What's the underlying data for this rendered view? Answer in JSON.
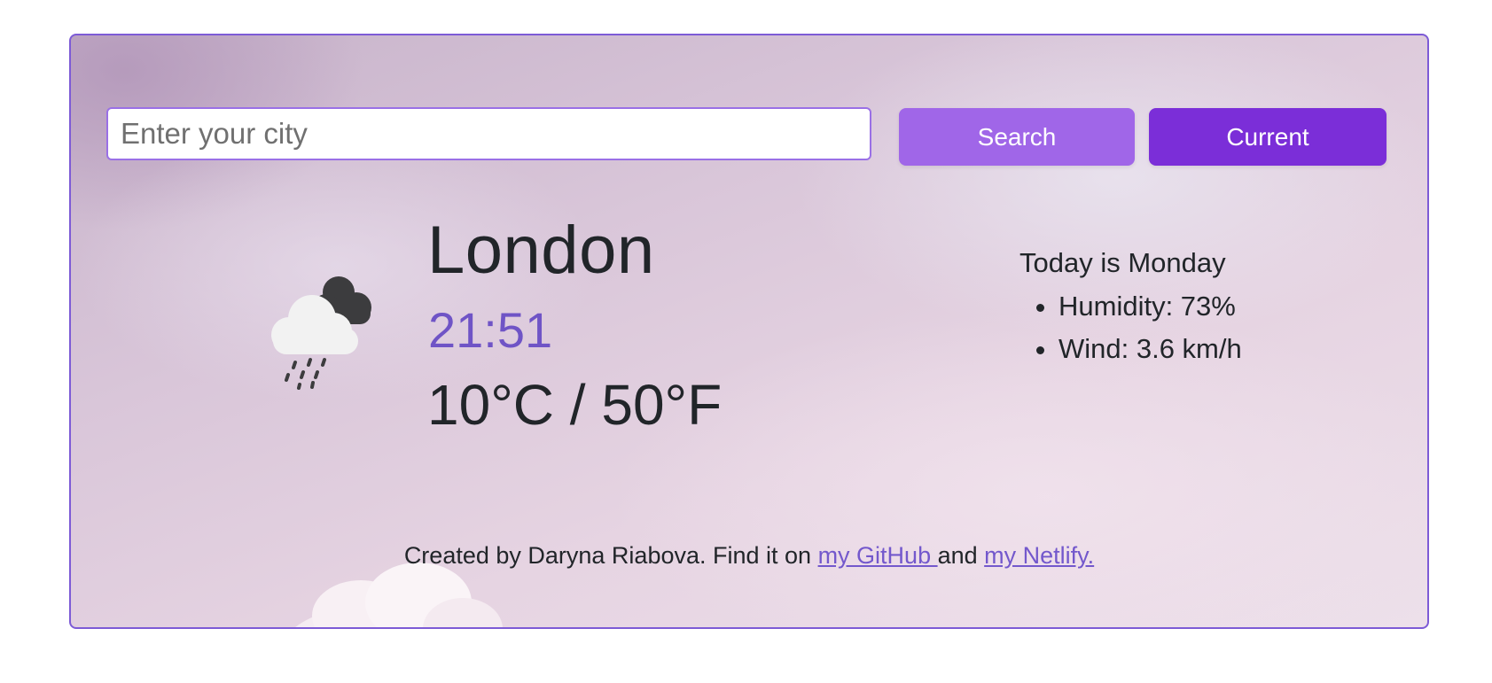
{
  "search": {
    "placeholder": "Enter your city",
    "value": "",
    "search_label": "Search",
    "current_label": "Current"
  },
  "weather": {
    "icon": "rain-cloud-icon",
    "city": "London",
    "time": "21:51",
    "temperature": "10°C / 50°F",
    "day": "Today is Monday",
    "humidity": "Humidity: 73%",
    "wind": "Wind: 3.6 km/h"
  },
  "footer": {
    "text_before": "Created by Daryna Riabova. Find it on ",
    "github_link": "my GitHub ",
    "text_middle": "and ",
    "netlify_link": "my Netlify."
  },
  "colors": {
    "accent": "#7d5bd6",
    "search_button": "#a066e8",
    "current_button": "#7b2ed8",
    "time_text": "#6f54c6"
  }
}
